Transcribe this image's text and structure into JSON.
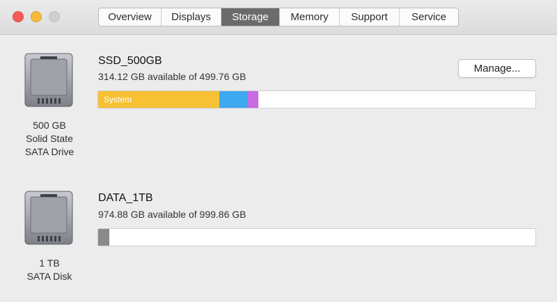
{
  "window": {
    "tabs": [
      {
        "label": "Overview"
      },
      {
        "label": "Displays"
      },
      {
        "label": "Storage"
      },
      {
        "label": "Memory"
      },
      {
        "label": "Support"
      },
      {
        "label": "Service"
      }
    ],
    "active_tab": "Storage"
  },
  "drives": [
    {
      "name": "SSD_500GB",
      "available": "314.12 GB available of 499.76 GB",
      "caption": [
        "500 GB",
        "Solid State",
        "SATA Drive"
      ],
      "icon": "hard-drive-icon",
      "manage_label": "Manage...",
      "segments": [
        {
          "label": "System",
          "fraction": 0.277,
          "color": "#f6c132"
        },
        {
          "label": "",
          "fraction": 0.065,
          "color": "#3fa9f0"
        },
        {
          "label": "",
          "fraction": 0.0,
          "color": "#6e7fe3"
        },
        {
          "label": "",
          "fraction": 0.025,
          "color": "#c86be0"
        }
      ]
    },
    {
      "name": "DATA_1TB",
      "available": "974.88 GB available of 999.86 GB",
      "caption": [
        "1 TB",
        "SATA Disk"
      ],
      "icon": "hard-drive-icon",
      "segments": [
        {
          "label": "",
          "fraction": 0.025,
          "color": "#8a8a8a"
        }
      ]
    }
  ]
}
